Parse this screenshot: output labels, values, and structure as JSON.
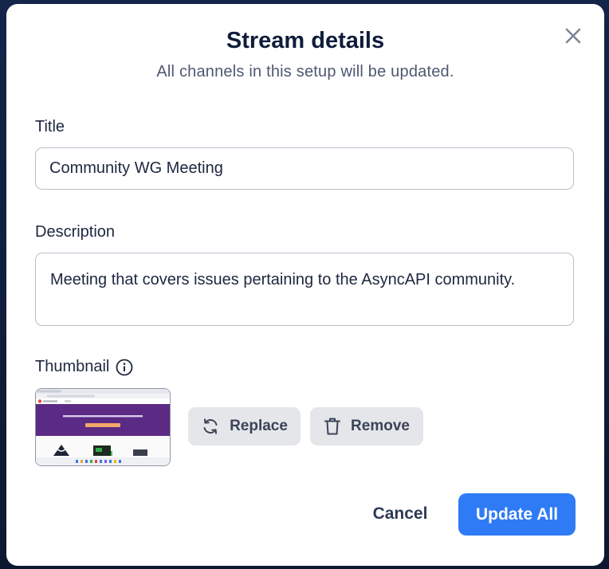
{
  "dialog": {
    "title": "Stream details",
    "subtitle": "All channels in this setup will be updated."
  },
  "form": {
    "title_label": "Title",
    "title_value": "Community WG Meeting",
    "description_label": "Description",
    "description_value": "Meeting that covers issues pertaining to the AsyncAPI community.",
    "thumbnail_label": "Thumbnail"
  },
  "thumbnail_actions": {
    "replace_label": "Replace",
    "remove_label": "Remove"
  },
  "footer": {
    "cancel_label": "Cancel",
    "update_label": "Update All"
  },
  "icons": {
    "close": "close-icon",
    "info": "info-icon",
    "replace": "refresh-icon",
    "remove": "trash-icon"
  },
  "colors": {
    "primary": "#2f7bf5",
    "heading": "#0f1d3a",
    "secondary_button_bg": "#e4e6ea",
    "thumbnail_banner": "#5b2a84"
  }
}
